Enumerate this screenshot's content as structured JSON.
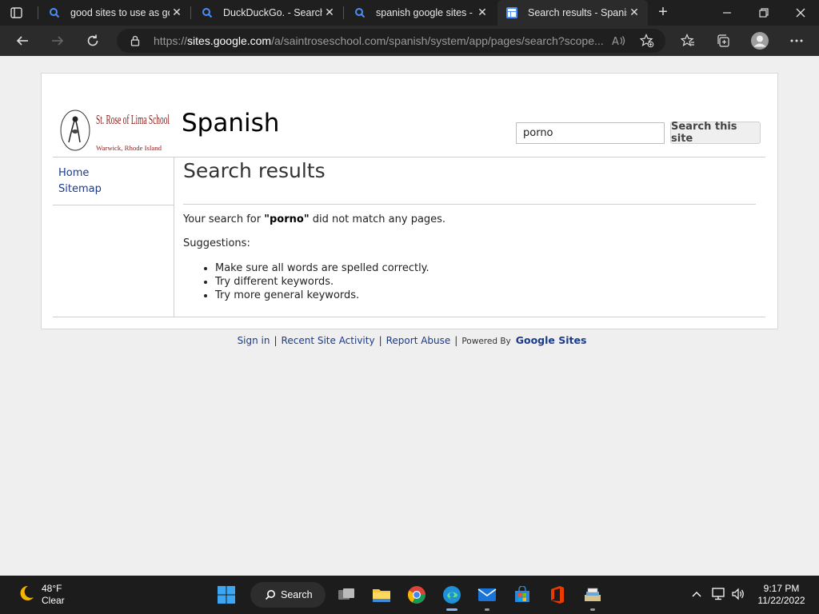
{
  "browser": {
    "tabs": [
      {
        "title": "good sites to use as go",
        "icon": "search-icon",
        "active": false
      },
      {
        "title": "DuckDuckGo. - Search",
        "icon": "search-icon",
        "active": false
      },
      {
        "title": "spanish google sites - S",
        "icon": "search-icon",
        "active": false
      },
      {
        "title": "Search results - Spanish",
        "icon": "sites-page-icon",
        "active": true
      }
    ],
    "url_prefix": "https://",
    "url_host": "sites.google.com",
    "url_path": "/a/saintroseschool.com/spanish/system/app/pages/search?scope..."
  },
  "site": {
    "logo_text": "St. Rose of Lima School",
    "logo_sub": "Warwick, Rhode Island",
    "title": "Spanish",
    "search_value": "porno",
    "search_button": "Search this site",
    "nav": [
      "Home",
      "Sitemap"
    ]
  },
  "results": {
    "heading": "Search results",
    "msg_prefix": "Your search for ",
    "query": "\"porno\"",
    "msg_suffix": " did not match any pages.",
    "suggestions_label": "Suggestions:",
    "suggestions": [
      "Make sure all words are spelled correctly.",
      "Try different keywords.",
      "Try more general keywords."
    ]
  },
  "footer": {
    "sign_in": "Sign in",
    "recent": "Recent Site Activity",
    "report": "Report Abuse",
    "powered": "Powered By",
    "google_sites": "Google Sites",
    "separator": "|"
  },
  "taskbar": {
    "temp": "48°F",
    "condition": "Clear",
    "search_label": "Search",
    "time": "9:17 PM",
    "date": "11/22/2022"
  },
  "colors": {
    "link": "#1a3a8a",
    "school_red": "#8b1a1a",
    "chrome_bg": "#2b2b2b"
  }
}
